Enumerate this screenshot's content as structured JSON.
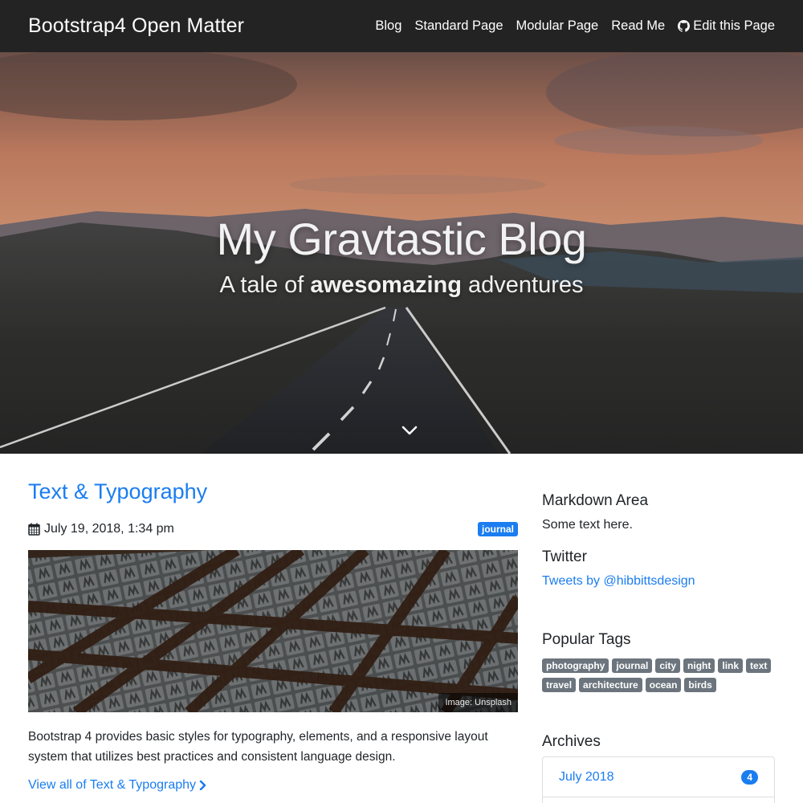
{
  "navbar": {
    "brand": "Bootstrap4 Open Matter",
    "links": [
      {
        "label": "Blog"
      },
      {
        "label": "Standard Page"
      },
      {
        "label": "Modular Page"
      },
      {
        "label": "Read Me"
      },
      {
        "label": "Edit this Page",
        "icon": "github-icon"
      }
    ]
  },
  "hero": {
    "title": "My Gravtastic Blog",
    "subtitle_prefix": "A tale of ",
    "subtitle_bold": "awesomazing",
    "subtitle_suffix": " adventures",
    "scroll_icon": "chevron-down-icon"
  },
  "post": {
    "title": "Text & Typography",
    "date": "July 19, 2018, 1:34 pm",
    "date_icon": "calendar-icon",
    "category": "journal",
    "image_credit": "Image: Unsplash",
    "excerpt": "Bootstrap 4 provides basic styles for typography, elements, and a responsive layout system that utilizes best practices and consistent language design.",
    "read_more": "View all of Text & Typography",
    "read_more_icon": "chevron-right-icon"
  },
  "sidebar": {
    "markdown": {
      "heading": "Markdown Area",
      "text": "Some text here."
    },
    "twitter": {
      "heading": "Twitter",
      "link": "Tweets by @hibbittsdesign"
    },
    "tags": {
      "heading": "Popular Tags",
      "items": [
        "photography",
        "journal",
        "city",
        "night",
        "link",
        "text",
        "travel",
        "architecture",
        "ocean",
        "birds"
      ]
    },
    "archives": {
      "heading": "Archives",
      "items": [
        {
          "label": "July 2018",
          "count": "4"
        }
      ]
    }
  },
  "colors": {
    "navbar_bg": "#232323",
    "link": "#1a7df0",
    "tag_bg": "#6c757d"
  }
}
